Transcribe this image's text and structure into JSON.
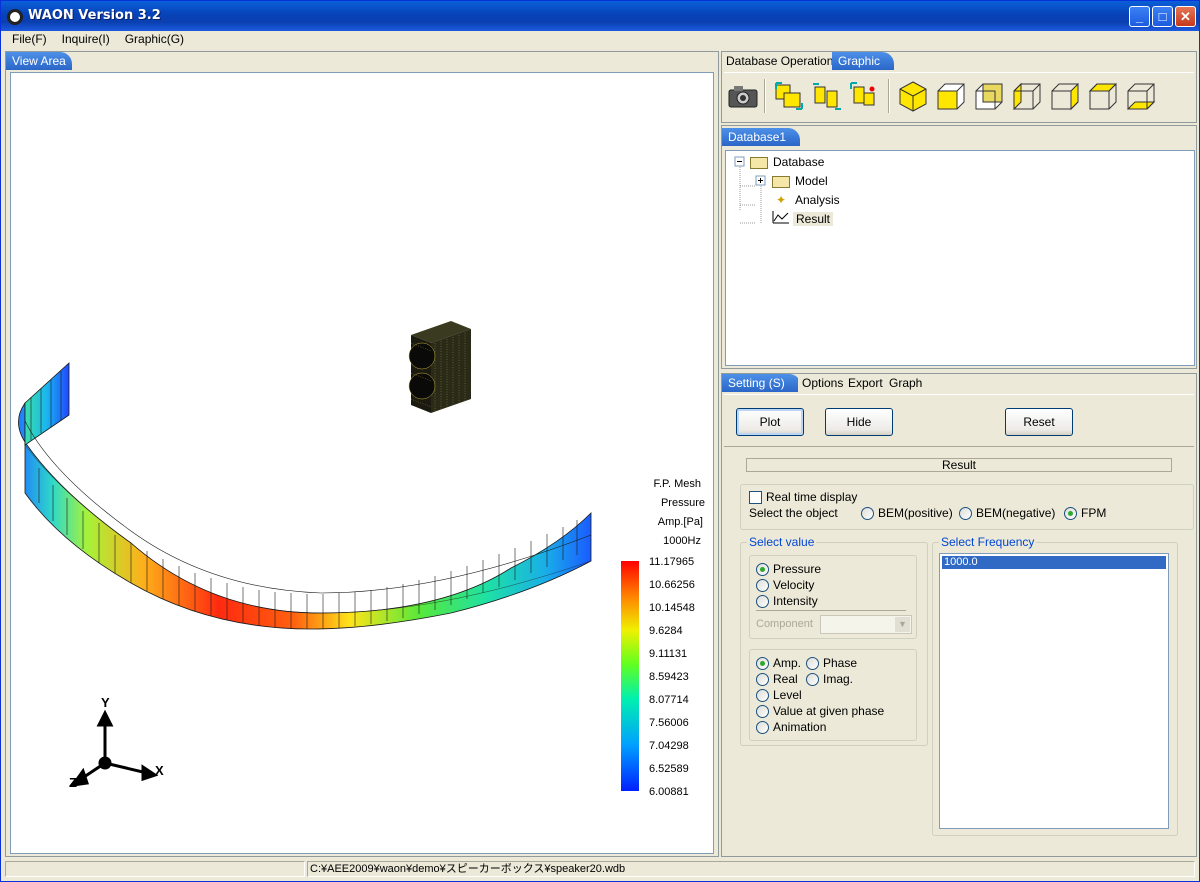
{
  "window": {
    "title": "WAON Version 3.2",
    "minimize": "_",
    "maximize": "□",
    "close": "✕"
  },
  "menu": [
    "File(F)",
    "Inquire(I)",
    "Graphic(G)"
  ],
  "left_tab": "View Area",
  "legend": {
    "header": [
      "F.P. Mesh",
      "Pressure",
      "Amp.[Pa]",
      "1000Hz"
    ],
    "ticks": [
      "11.17965",
      "10.66256",
      "10.14548",
      "9.6284",
      "9.11131",
      "8.59423",
      "8.07714",
      "7.56006",
      "7.04298",
      "6.52589",
      "6.00881"
    ]
  },
  "axes": {
    "x": "X",
    "y": "Y",
    "z": "Z"
  },
  "right_tabs": {
    "db_operation": "Database Operation",
    "graphic": "Graphic"
  },
  "toolbar_icons": [
    "camera-icon",
    "fit-view-icon",
    "zoom-view-icon",
    "center-view-icon",
    "iso-view-icon",
    "front-view-icon",
    "back-view-icon",
    "left-view-icon",
    "right-view-icon",
    "top-view-icon",
    "bottom-view-icon"
  ],
  "database_tab": "Database1",
  "tree": {
    "root": "Database",
    "model": "Model",
    "analysis": "Analysis",
    "result": "Result"
  },
  "settings_tabs": {
    "setting": "Setting (S)",
    "options": "Options",
    "export": "Export",
    "graph": "Graph"
  },
  "buttons": {
    "plot": "Plot",
    "hide": "Hide",
    "reset": "Reset"
  },
  "result_header": "Result",
  "realtime": "Real time display",
  "select_object": {
    "label": "Select the object",
    "options": [
      "BEM(positive)",
      "BEM(negative)",
      "FPM"
    ],
    "selected": "FPM"
  },
  "select_value": {
    "label": "Select value",
    "options": [
      "Pressure",
      "Velocity",
      "Intensity"
    ],
    "selected": "Pressure",
    "component_label": "Component"
  },
  "display": {
    "amp": "Amp.",
    "phase": "Phase",
    "real": "Real",
    "imag": "Imag.",
    "level": "Level",
    "value_phase": "Value at given phase",
    "animation": "Animation",
    "selected": "Amp."
  },
  "frequency": {
    "label": "Select Frequency",
    "items": [
      "1000.0"
    ]
  },
  "status": {
    "path": "C:¥AEE2009¥waon¥demo¥スピーカーボックス¥speaker20.wdb"
  },
  "colors": {
    "accent": "#0a246a",
    "title_blue": "#0a4bc8",
    "selected": "#316ac5"
  }
}
